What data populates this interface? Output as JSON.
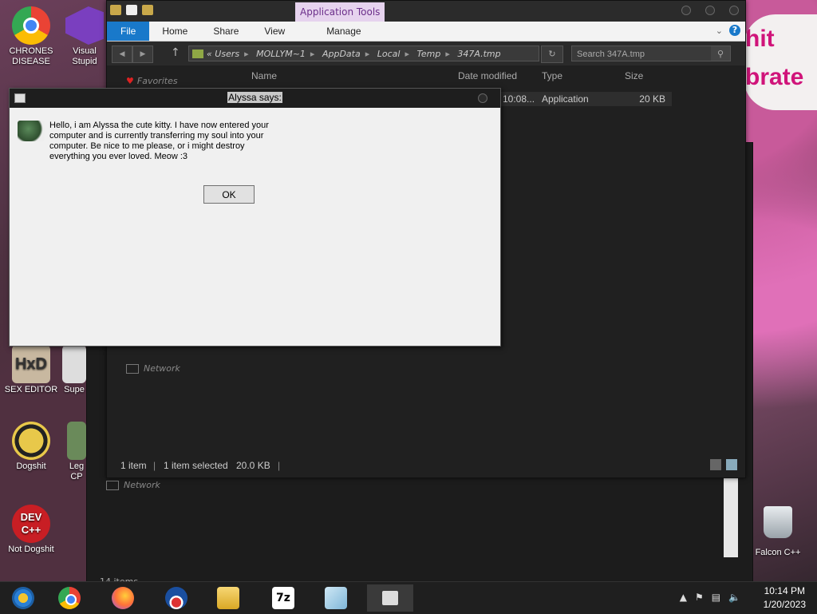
{
  "desktop": {
    "icons": [
      {
        "label": "CHRONES DISEASE",
        "icon": "chrome-icon"
      },
      {
        "label": "Visual Stupid",
        "icon": "visual-studio-icon"
      },
      {
        "label": "SEX EDITOR",
        "icon": "hxd-icon"
      },
      {
        "label": "Supe",
        "icon": "app-icon"
      },
      {
        "label": "Dogshit",
        "icon": "dogshit-icon"
      },
      {
        "label": "Leg CP",
        "icon": "app-icon"
      },
      {
        "label": "Not Dogshit",
        "icon": "dev-cpp-icon"
      },
      {
        "label": "Falcon C++",
        "icon": "recycle-bin-icon"
      }
    ],
    "wallpaper_text": [
      "hit",
      "brate"
    ]
  },
  "explorer": {
    "context_tab": "Application Tools",
    "ribbon_tabs": [
      "File",
      "Home",
      "Share",
      "View",
      "Manage"
    ],
    "address_path": [
      "Users",
      "MOLLYM~1",
      "AppData",
      "Local",
      "Temp",
      "347A.tmp"
    ],
    "search_placeholder": "Search 347A.tmp",
    "columns": {
      "name": "Name",
      "date": "Date modified",
      "type": "Type",
      "size": "Size"
    },
    "nav": {
      "favorites": "Favorites",
      "network": "Network",
      "network2": "Network"
    },
    "file": {
      "date": "10:08...",
      "type": "Application",
      "size": "20 KB"
    },
    "status": {
      "count": "1 item",
      "selected": "1 item selected",
      "size": "20.0 KB"
    },
    "behind_status": "14 items"
  },
  "dialog": {
    "title": "Alyssa says:",
    "message": "Hello, i am Alyssa the cute kitty. I have now entered your computer and is currently transferring my soul into your computer. Be nice to me please, or i might destroy everything you ever loved. Meow :3",
    "ok_label": "OK"
  },
  "taskbar": {
    "apps": [
      "start-orb-icon",
      "chrome-icon",
      "firefox-icon",
      "obama-icon",
      "file-explorer-icon",
      "7zip-icon",
      "notepad-icon",
      "window-icon"
    ],
    "sevenzip_text": "7z",
    "devcpp_text": "DEV C++",
    "time": "10:14 PM",
    "date": "1/20/2023"
  }
}
